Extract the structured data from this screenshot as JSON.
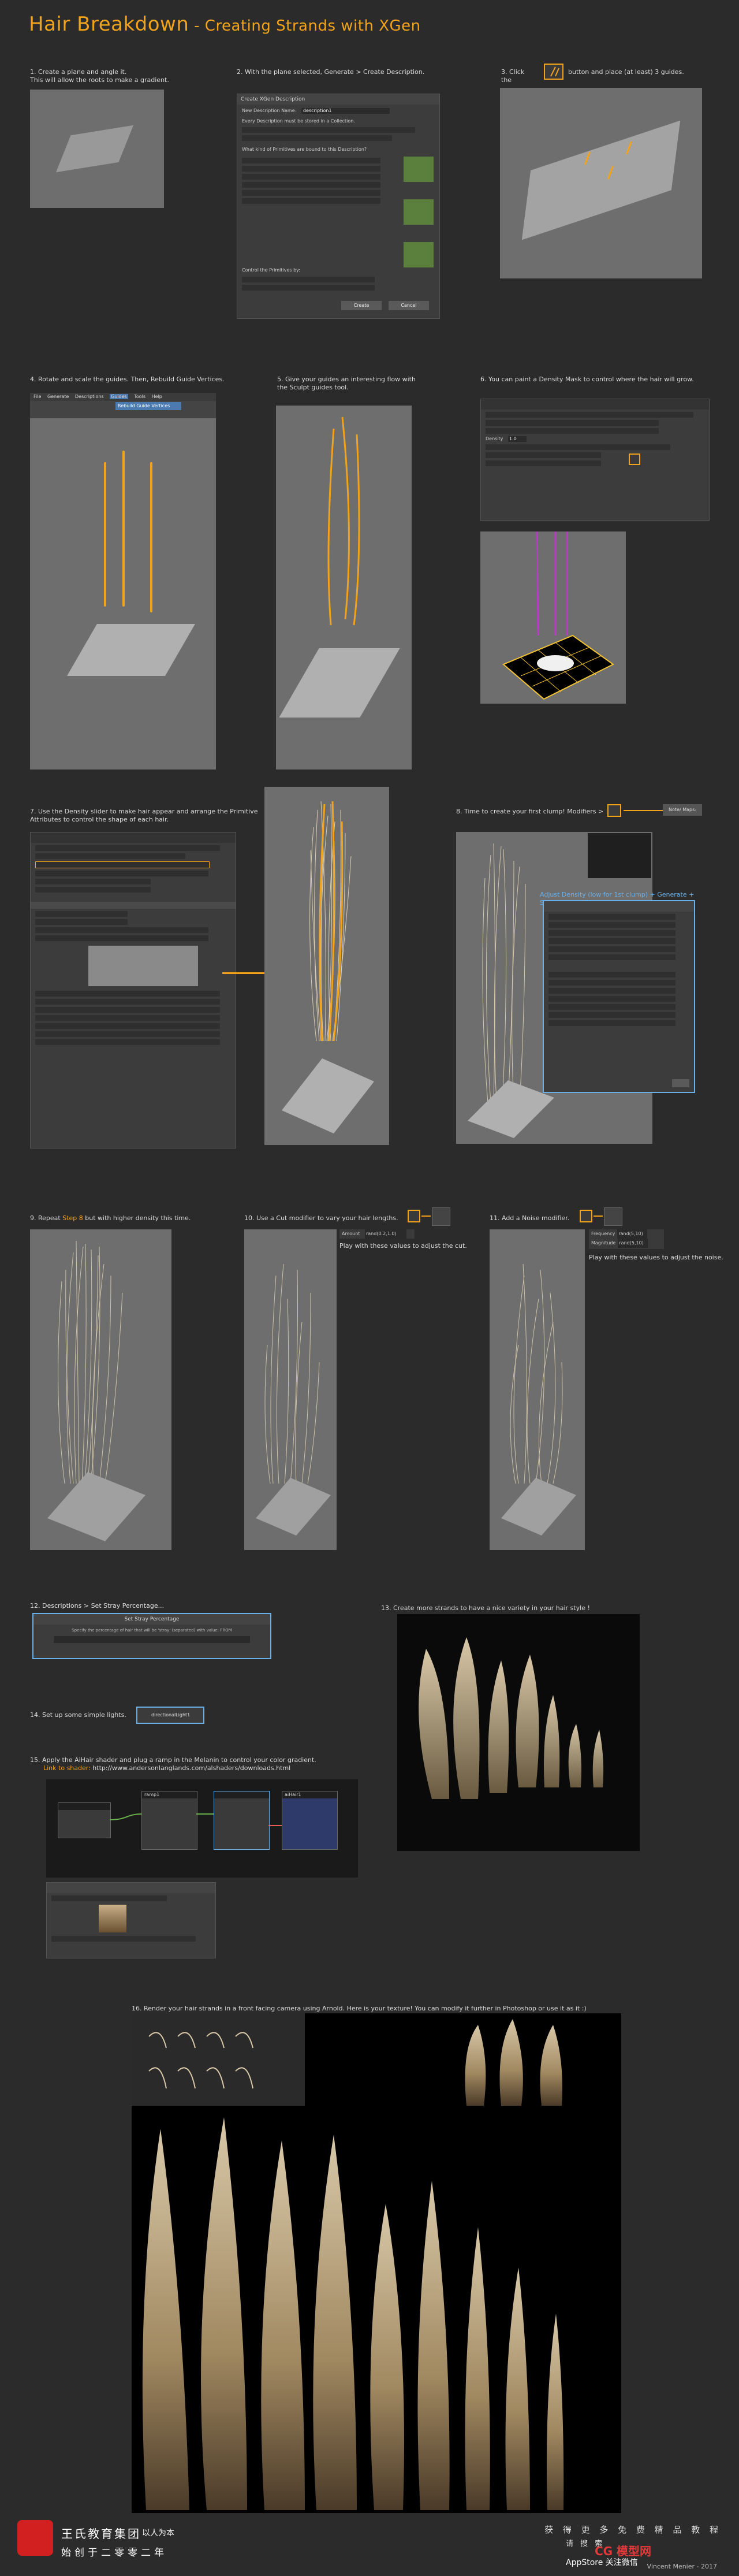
{
  "header": {
    "title": "Hair Breakdown",
    "subtitle": " - Creating Strands with XGen"
  },
  "steps": {
    "s1": "1. Create a plane and angle it.\nThis will allow the roots to make a gradient.",
    "s2": "2. With the plane selected, Generate > Create Description.",
    "s3a": "3.  Click the",
    "s3b": "button and place (at least) 3 guides.",
    "s4": "4. Rotate and scale the guides. Then, Rebuild Guide Vertices.",
    "s5": "5. Give your guides an interesting flow with the Sculpt guides tool.",
    "s6": "6. You can paint a Density Mask to control where the hair will grow.",
    "s7": "7. Use the Density slider to make hair appear and arrange the Primitive Attributes to control the shape of each hair.",
    "s8": "8. Time to create your first clump! Modifiers >",
    "s8b": "Note/ Maps:",
    "s8c": "Adjust Density (low for 1st clump) + Generate + Save",
    "s9a": "9. Repeat ",
    "s9b": "Step 8",
    "s9c": " but with higher density this time.",
    "s10": "10. Use a Cut modifier to vary your hair lengths.",
    "s10b": "Play with these values to adjust the cut.",
    "s11": "11. Add a Noise modifier.",
    "s11b": "Play with these values to adjust the noise.",
    "s12": "12. Descriptions > Set Stray Percentage...",
    "s13": "13. Create more strands to have a nice variety in your hair style !",
    "s14": "14. Set up some simple lights.",
    "s15": "15. Apply the AiHair shader and plug a ramp in the Melanin to control your color gradient.",
    "s15link_label": "Link to shader:",
    "s15link": " http://www.andersonlanglands.com/alshaders/downloads.html",
    "s16": "16. Render your hair strands in a front facing camera using Arnold. Here is your texture! You can modify it further in Photoshop or use it as it :)"
  },
  "dialog_create_desc": {
    "title": "Create XGen Description",
    "name_label": "New Description Name:",
    "name_value": "description1",
    "q1": "Every Description must be stored in a Collection.",
    "q2": "What kind of Primitives are bound to this Description?",
    "q3": "Control the Primitives by:",
    "create": "Create",
    "cancel": "Cancel"
  },
  "dialog_stray": {
    "title": "Set Stray Percentage",
    "text": "Specify the percentage of hair that will be 'stray' (separated) with value: FROM",
    "ok": "OK"
  },
  "panels": {
    "menu_items": [
      "File",
      "Generate",
      "Descriptions",
      "Guides",
      "Tools",
      "Help"
    ],
    "menu_pick": "Rebuild Guide Vertices",
    "density_label": "Density",
    "density_value": "1.0",
    "lights_node": "directionalLight1",
    "shader_node": "aiHair1",
    "ramp_node": "ramp1",
    "cut_label": "Amount",
    "cut_value": "rand(0.2,1.0)",
    "noise_label1": "Frequency",
    "noise_label2": "Magnitude",
    "noise_value1": "rand(5,10)",
    "noise_value2": "rand(5,10)"
  },
  "footer": {
    "brand_cn": "王氏教育集团",
    "brand_tag": "以人为本",
    "brand_cn2": "始创于二零零二年",
    "right_top": "获 得 更 多 免 费 精 品 教 程",
    "right_mid": "请 搜 索",
    "appstore": "AppStore 关注微信",
    "credit": "Vincent Menier - 2017",
    "wm": "CG 模型网"
  },
  "colors": {
    "accent": "#f2a31b",
    "background": "#2b2b2b"
  }
}
